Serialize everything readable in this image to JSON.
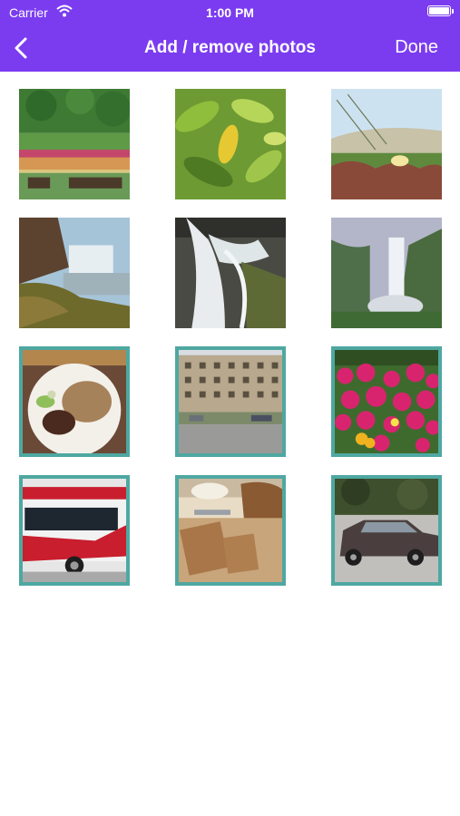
{
  "status_bar": {
    "carrier": "Carrier",
    "time": "1:00 PM"
  },
  "nav": {
    "title": "Add / remove photos",
    "done_label": "Done"
  },
  "colors": {
    "nav_background": "#7b3cf0",
    "selection_border": "#4ea8a1"
  },
  "photos": [
    {
      "name": "photo-garden",
      "selected": true
    },
    {
      "name": "photo-yellow-leaf",
      "selected": false
    },
    {
      "name": "photo-dune-flower",
      "selected": false
    },
    {
      "name": "photo-waterfall-cliff",
      "selected": false
    },
    {
      "name": "photo-waterfall-closeup",
      "selected": false
    },
    {
      "name": "photo-waterfall-mist",
      "selected": false
    },
    {
      "name": "photo-food-plate",
      "selected": true
    },
    {
      "name": "photo-building",
      "selected": true
    },
    {
      "name": "photo-pink-flowers",
      "selected": true
    },
    {
      "name": "photo-bus",
      "selected": true
    },
    {
      "name": "photo-bread",
      "selected": true
    },
    {
      "name": "photo-car",
      "selected": true
    }
  ]
}
